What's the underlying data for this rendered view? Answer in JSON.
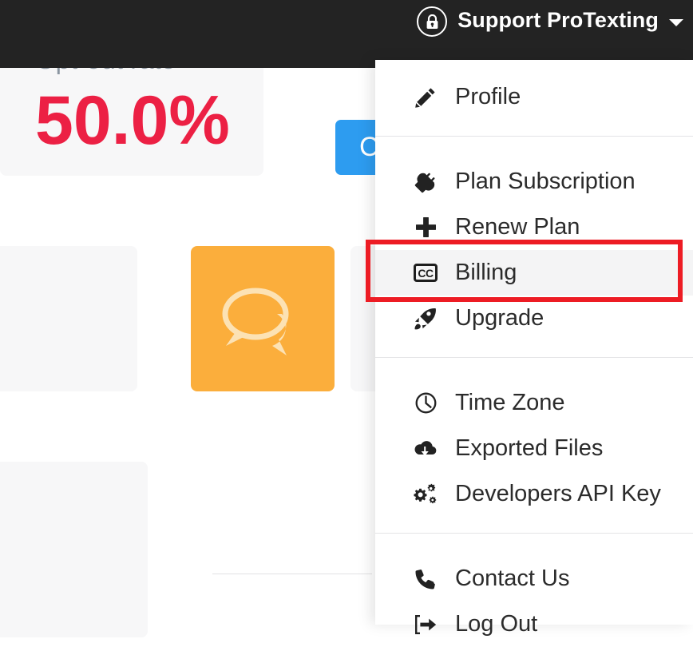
{
  "header": {
    "account_name": "Support ProTexting",
    "lock_icon": "lock-circle-icon",
    "caret_icon": "chevron-down-icon",
    "background_color": "#232323"
  },
  "background": {
    "blue_button_label": "C",
    "blue_button_color": "#2d9cf0",
    "orange_card_color": "#fbae3c",
    "orange_card_icon": "chat-bubbles-icon",
    "stat_card": {
      "label": "Opt-out rate",
      "value": "50.0%",
      "value_color": "#ec2044",
      "label_color": "#8a95a0"
    }
  },
  "dropdown": {
    "groups": [
      {
        "items": [
          {
            "label": "Profile",
            "icon": "pencil-icon",
            "active": false
          }
        ]
      },
      {
        "items": [
          {
            "label": "Plan Subscription",
            "icon": "plug-icon",
            "active": false
          },
          {
            "label": "Renew Plan",
            "icon": "plus-icon",
            "active": false
          },
          {
            "label": "Billing",
            "icon": "cc-badge-icon",
            "icon_text": "CC",
            "active": true
          },
          {
            "label": "Upgrade",
            "icon": "rocket-icon",
            "active": false
          }
        ]
      },
      {
        "items": [
          {
            "label": "Time Zone",
            "icon": "clock-icon",
            "active": false
          },
          {
            "label": "Exported Files",
            "icon": "cloud-download-icon",
            "active": false
          },
          {
            "label": "Developers API Key",
            "icon": "gears-icon",
            "active": false
          }
        ]
      },
      {
        "items": [
          {
            "label": "Contact Us",
            "icon": "phone-icon",
            "active": false
          },
          {
            "label": "Log Out",
            "icon": "sign-out-icon",
            "active": false
          }
        ]
      }
    ]
  },
  "annotation": {
    "target_label": "Billing",
    "color": "#ed1c24"
  }
}
